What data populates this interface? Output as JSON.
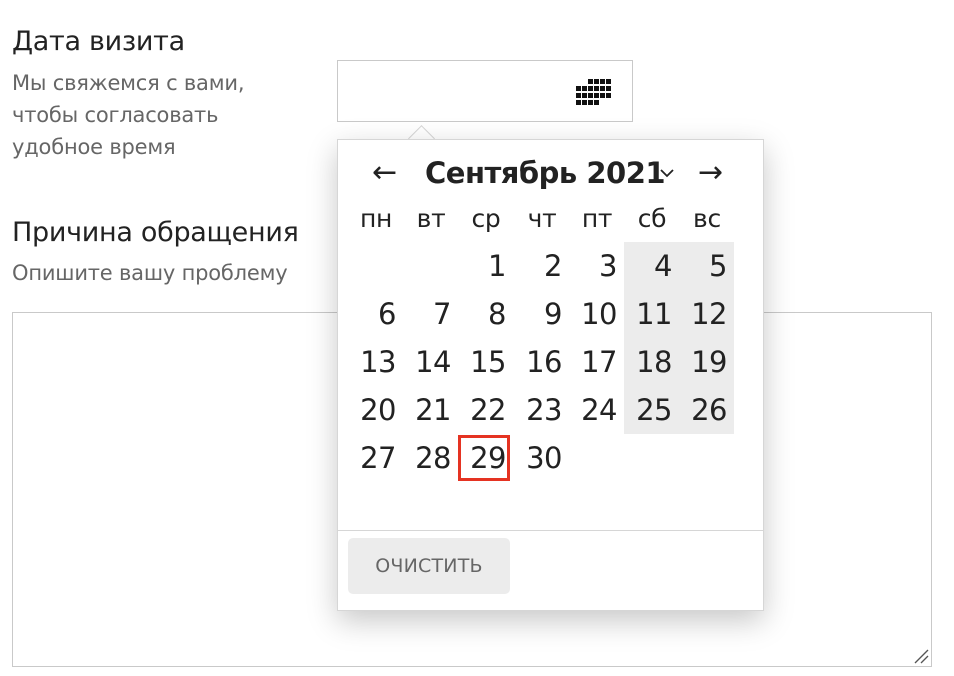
{
  "visit_date": {
    "title": "Дата визита",
    "hint_lines": [
      "Мы свяжемся с вами,",
      "чтобы согласовать",
      "удобное время"
    ],
    "input_value": "",
    "icon": "calendar-grid-icon"
  },
  "reason": {
    "title": "Причина обращения",
    "hint": "Опишите вашу проблему",
    "textarea_value": ""
  },
  "calendar": {
    "prev_label": "←",
    "next_label": "→",
    "month_title": "Сентябрь 2021",
    "weekdays": [
      "пн",
      "вт",
      "ср",
      "чт",
      "пт",
      "сб",
      "вс"
    ],
    "days": [
      "1",
      "2",
      "3",
      "4",
      "5",
      "6",
      "7",
      "8",
      "9",
      "10",
      "11",
      "12",
      "13",
      "14",
      "15",
      "16",
      "17",
      "18",
      "19",
      "20",
      "21",
      "22",
      "23",
      "24",
      "25",
      "26",
      "27",
      "28",
      "29",
      "30"
    ],
    "today": "29",
    "highlight_color": "#e53322",
    "weekend_bg_color": "#ececec",
    "clear_label": "ОЧИСТИТЬ"
  }
}
